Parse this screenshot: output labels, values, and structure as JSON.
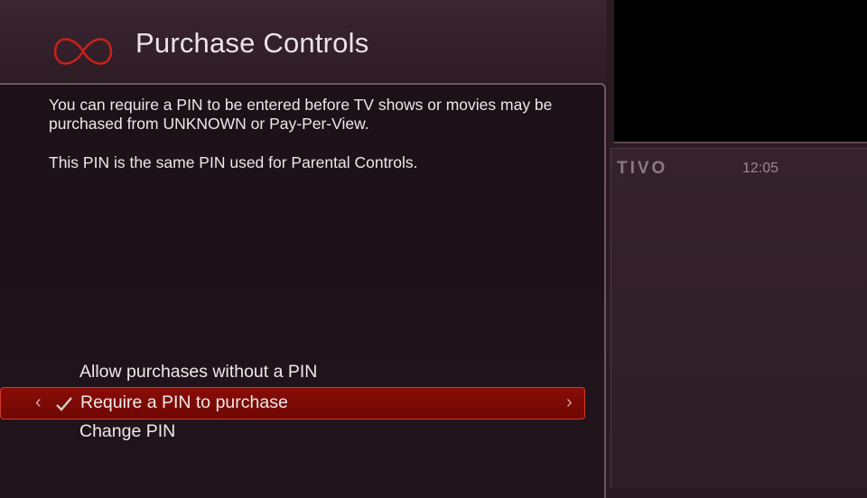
{
  "header": {
    "title": "Purchase Controls",
    "logo_icon": "infinity-logo-icon",
    "logo_color": "#c8221b"
  },
  "main": {
    "description_1": "You can require a PIN to be entered before TV shows or movies may be purchased from UNKNOWN or Pay-Per-View.",
    "description_2": "This PIN is the same PIN used for Parental Controls.",
    "options": [
      {
        "label": "Allow purchases without a PIN",
        "selected": false
      },
      {
        "label": "Require a PIN to purchase",
        "selected": true,
        "checked": true
      },
      {
        "label": "Change PIN",
        "selected": false
      }
    ],
    "chevron_left": "‹",
    "chevron_right": "›",
    "highlight_color": "#7a0a05"
  },
  "sidebar": {
    "brand": "TiVo",
    "time": "12:05"
  }
}
